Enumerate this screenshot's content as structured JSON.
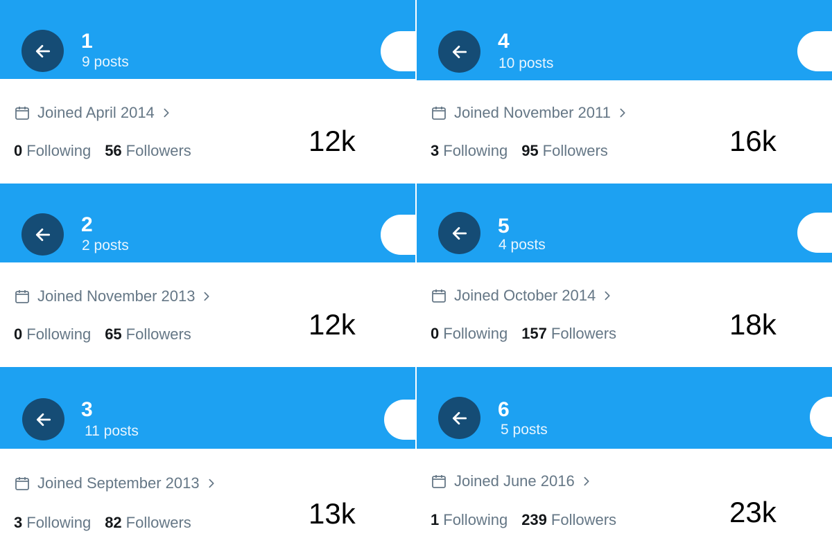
{
  "panels": [
    {
      "number": "1",
      "posts": "9 posts",
      "joined": "Joined April 2014",
      "following_count": "0",
      "following_label": "Following",
      "followers_count": "56",
      "followers_label": "Followers",
      "big_label": "12k"
    },
    {
      "number": "2",
      "posts": "2 posts",
      "joined": "Joined November 2013",
      "following_count": "0",
      "following_label": "Following",
      "followers_count": "65",
      "followers_label": "Followers",
      "big_label": "12k"
    },
    {
      "number": "3",
      "posts": "11 posts",
      "joined": "Joined September 2013",
      "following_count": "3",
      "following_label": "Following",
      "followers_count": "82",
      "followers_label": "Followers",
      "big_label": "13k"
    },
    {
      "number": "4",
      "posts": "10 posts",
      "joined": "Joined November 2011",
      "following_count": "3",
      "following_label": "Following",
      "followers_count": "95",
      "followers_label": "Followers",
      "big_label": "16k"
    },
    {
      "number": "5",
      "posts": "4 posts",
      "joined": "Joined October 2014",
      "following_count": "0",
      "following_label": "Following",
      "followers_count": "157",
      "followers_label": "Followers",
      "big_label": "18k"
    },
    {
      "number": "6",
      "posts": "5 posts",
      "joined": "Joined June 2016",
      "following_count": "1",
      "following_label": "Following",
      "followers_count": "239",
      "followers_label": "Followers",
      "big_label": "23k"
    }
  ],
  "colors": {
    "header": "#1da1f2",
    "back_button": "#154c75",
    "muted_text": "#657786",
    "strong_text": "#14171a"
  },
  "icons": {
    "back": "arrow-left-icon",
    "joined": "calendar-icon",
    "joined_chevron": "chevron-right-icon"
  }
}
